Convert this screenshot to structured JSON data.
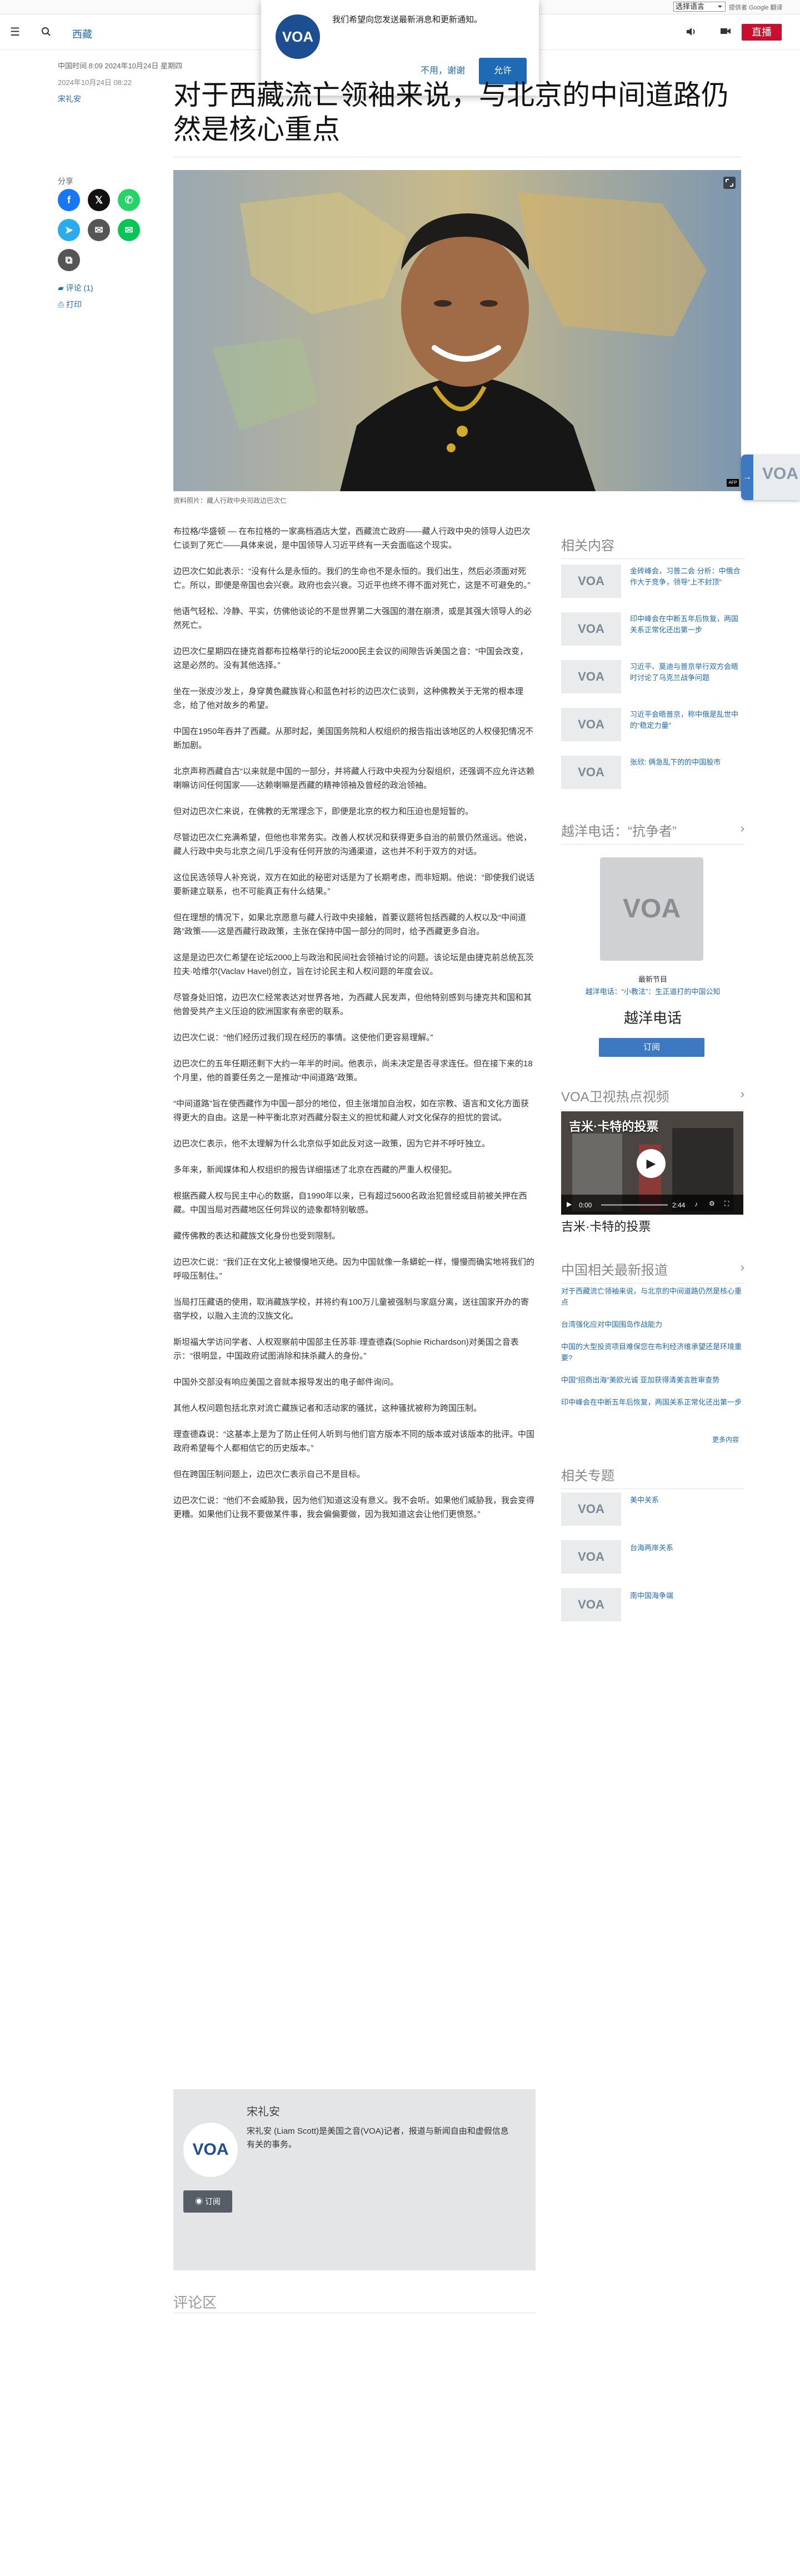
{
  "top": {
    "language_select": "选择语言",
    "google_translate": "提供者 Google 翻译"
  },
  "header": {
    "section": "西藏",
    "live_label": "直播"
  },
  "notification": {
    "logo_text": "VOA",
    "message": "我们希望向您发送最新消息和更新通知。",
    "decline_label": "不用，谢谢",
    "allow_label": "允许"
  },
  "article": {
    "date": "中国时间 8:09 2024年10月24日 星期四",
    "updated": "2024年10月24日 08:22",
    "author": "宋礼安",
    "headline": "对于西藏流亡领袖来说，与北京的中间道路仍然是核心重点",
    "hero_credit": "AFP",
    "hero_caption": "资料照片：藏人行政中央司政边巴次仁",
    "paragraphs": [
      "布拉格/华盛顿 — 在布拉格的一家高档酒店大堂，西藏流亡政府——藏人行政中央的领导人边巴次仁谈到了死亡——具体来说，是中国领导人习近平终有一天会面临这个现实。",
      "边巴次仁如此表示：“没有什么是永恒的。我们的生命也不是永恒的。我们出生，然后必须面对死亡。所以，即便是帝国也会兴衰。政府也会兴衰。习近平也终不得不面对死亡，这是不可避免的。”",
      "他语气轻松、冷静、平实，仿佛他谈论的不是世界第二大强国的潜在崩溃，或是其强大领导人的必然死亡。",
      "边巴次仁星期四在捷克首都布拉格举行的论坛2000民主会议的间隙告诉美国之音：“中国会改变，这是必然的。没有其他选择。”",
      "坐在一张皮沙发上，身穿黄色藏族背心和蓝色衬衫的边巴次仁谈到，这种佛教关于无常的根本理念，给了他对故乡的希望。",
      "中国在1950年吞并了西藏。从那时起，美国国务院和人权组织的报告指出该地区的人权侵犯情况不断加剧。",
      "北京声称西藏自古“以来就是中国的一部分，并将藏人行政中央视为分裂组织，还强调不应允许达赖喇嘛访问任何国家——达赖喇嘛是西藏的精神领袖及曾经的政治领袖。",
      "但对边巴次仁来说，在佛教的无常理念下，即便是北京的权力和压迫也是短暂的。",
      "尽管边巴次仁充满希望，但他也非常务实。改善人权状况和获得更多自治的前景仍然遥远。他说，藏人行政中央与北京之间几乎没有任何开放的沟通渠道，这也并不利于双方的对话。",
      "这位民选领导人补充说，双方在如此的秘密对话是为了长期考虑，而非短期。他说：“即使我们说话要新建立联系，也不可能真正有什么结果。”",
      "但在理想的情况下，如果北京愿意与藏人行政中央接触，首要议题将包括西藏的人权以及“中间道路”政策——这是西藏行政政策，主张在保持中国一部分的同时，给予西藏更多自治。",
      "这是是边巴次仁希望在论坛2000上与政治和民间社会领袖讨论的问题。该论坛是由捷克前总统瓦茨拉夫·哈维尔(Vaclav Havel)创立，旨在讨论民主和人权问题的年度会议。",
      "尽管身处旧馆，边巴次仁经常表达对世界各地，为西藏人民发声，但他特别感到与捷克共和国和其他曾受共产主义压迫的欧洲国家有亲密的联系。",
      "边巴次仁说：“他们经历过我们现在经历的事情。这使他们更容易理解。”",
      "边巴次仁的五年任期还剩下大约一年半的时间。他表示，尚未决定是否寻求连任。但在接下来的18个月里，他的首要任务之一是推动“中间道路”政策。",
      "“中间道路”旨在使西藏作为中国一部分的地位，但主张增加自治权，如在宗教、语言和文化方面获得更大的自由。这是一种平衡北京对西藏分裂主义的担忧和藏人对文化保存的担忧的尝试。",
      "边巴次仁表示，他不太理解为什么北京似乎如此反对这一政策，因为它并不呼吁独立。",
      "多年来，新闻媒体和人权组织的报告详细描述了北京在西藏的严重人权侵犯。",
      "根据西藏人权与民主中心的数据，自1990年以来，已有超过5600名政治犯曾经或目前被关押在西藏。中国当局对西藏地区任何异议的迹象都特别敏感。",
      "藏传佛教的表达和藏族文化身份也受到限制。",
      "边巴次仁说：“我们正在文化上被慢慢地灭绝。因为中国就像一条蟒蛇一样，慢慢而确实地将我们的呼吸压制住。”",
      "当局打压藏语的使用，取消藏族学校，并将约有100万儿童被强制与家庭分离，送往国家开办的寄宿学校，以融入主流的汉族文化。",
      "斯坦福大学访问学者、人权观察前中国部主任苏菲·理查德森(Sophie Richardson)对美国之音表示：“很明显，中国政府试图消除和抹杀藏人的身份。”",
      "中国外交部没有响应美国之音就本报导发出的电子邮件询问。",
      "其他人权问题包括北京对流亡藏族记者和活动家的骚扰，这种骚扰被称为跨国压制。",
      "理查德森说：“这基本上是为了防止任何人听到与他们官方版本不同的版本或对该版本的批评。中国政府希望每个人都相信它的历史版本。”",
      "但在跨国压制问题上，边巴次仁表示自己不是目标。",
      "边巴次仁说：“他们不会威胁我，因为他们知道这没有意义。我不会听。如果他们威胁我，我会变得更糟。如果他们让我不要做某件事，我会偏偏要做，因为我知道这会让他们更愤怒。”"
    ]
  },
  "share": {
    "label": "分享",
    "comments_label": "评论 (1)",
    "print_label": "打印"
  },
  "author_box": {
    "name": "宋礼安",
    "bio": "宋礼安 (Liam Scott)是美国之音(VOA)记者，报道与新闻自由和虚假信息有关的事务。",
    "avatar_text": "VOA",
    "subscribe_label": "订阅"
  },
  "comments_heading": "评论区",
  "rail": {
    "related_title": "相关内容",
    "related": [
      {
        "thumb": "VOA",
        "title": "金砖峰会，习普二会 分析：中俄合作大于竞争，领导“上不封顶”"
      },
      {
        "thumb": "VOA",
        "title": "印中峰会在中断五年后恢复，两国关系正常化还出第一步"
      },
      {
        "thumb": "VOA",
        "title": "习近平、莫迪与普京举行双方会晤时讨论了乌克兰战争问题"
      },
      {
        "thumb": "VOA",
        "title": "习近平会晤普京，称中俄是乱世中的“稳定力量”"
      },
      {
        "thumb": "VOA",
        "title": "张欣: 俩急乱下的的中国股市"
      }
    ],
    "radio_title": "越洋电话：“抗争者”",
    "radio_logo": "VOA",
    "radio_label": "最新节目",
    "radio_link": "越洋电话：“小教法”：生正道打的中国公知",
    "radio_name": "越洋电话",
    "radio_subscribe": "订阅",
    "video_title": "VOA卫视热点视频",
    "video_overlay": "吉米·卡特的投票",
    "video_time": "0:00",
    "video_duration": "2:44",
    "video_caption": "吉米·卡特的投票",
    "news_title": "中国相关最新报道",
    "news": [
      "对于西藏流亡领袖来说，与北京的中间道路仍然是核心重点",
      "台湾强化应对中国围岛作战能力",
      "中国的大型投资项目难保您在布利经济维承望还是环境重要?",
      "中国“招商出海”美欧光诚 亚加获得清美言胜审查势",
      "印中峰会在中断五年后恢复，两国关系正常化还出第一步"
    ],
    "more_label": "更多内容",
    "topics_title": "相关专题",
    "topics": [
      {
        "thumb": "VOA",
        "title": "美中关系"
      },
      {
        "thumb": "VOA",
        "title": "台海两岸关系"
      },
      {
        "thumb": "VOA",
        "title": "南中国海争端"
      }
    ]
  },
  "float_tab": {
    "logo": "VOA"
  },
  "colors": {
    "brand": "#1f6ab5",
    "live": "#c8102e",
    "voa_blue": "#1d4e92"
  }
}
